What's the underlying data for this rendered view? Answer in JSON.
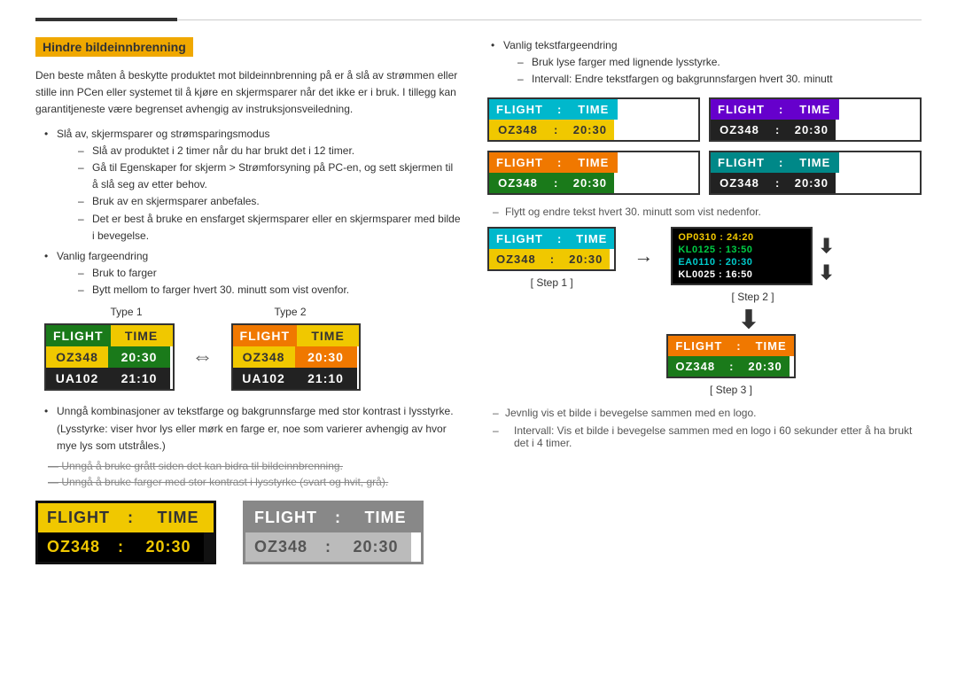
{
  "page": {
    "top_border_dark_width": 160
  },
  "section": {
    "title": "Hindre bildeinnbrenning",
    "intro": "Den beste måten å beskytte produktet mot bildeinnbrenning på er å slå av strømmen eller stille inn PCen eller systemet til å kjøre en skjermsparer når det ikke er i bruk. I tillegg kan garantitjeneste være begrenset avhengig av instruksjonsveiledning.",
    "bullets": [
      {
        "main": "Slå av, skjermsparer og strømsparingsmodus",
        "dashes": [
          "Slå av produktet i 2 timer når du har brukt det i 12 timer.",
          "Gå til Egenskaper for skjerm > Strømforsyning på PC-en, og sett skjermen til å slå seg av etter behov.",
          "Bruk av en skjermsparer anbefales.",
          "Det er best å bruke en ensfarget skjermsparer eller en skjermsparer med bilde i bevegelse."
        ]
      },
      {
        "main": "Vanlig fargeendring",
        "dashes": [
          "Bruk to farger",
          "Bytt mellom to farger hvert 30. minutt som vist ovenfor."
        ]
      }
    ],
    "type1_label": "Type 1",
    "type2_label": "Type 2",
    "board1": {
      "row1": [
        "FLIGHT",
        "TIME"
      ],
      "row2": [
        "OZ348",
        "20:30"
      ],
      "row3": [
        "UA102",
        "21:10"
      ]
    },
    "board2": {
      "row1": [
        "FLIGHT",
        "TIME"
      ],
      "row2": [
        "OZ348",
        "20:30"
      ],
      "row3": [
        "UA102",
        "21:10"
      ]
    },
    "avoid_bullet1": "Unngå kombinasjoner av tekstfarge og bakgrunnsfarge med stor kontrast i lysstyrke. (Lysstyrke: viser hvor lys eller mørk en farge er, noe som varierer avhengig av hvor mye lys som utstråles.)",
    "strikethrough1": "Unngå å bruke grått siden det kan bidra til bildeinnbrenning.",
    "strikethrough2": "Unngå å bruke farger med stor kontrast i lysstyrke (svart og hvit, grå).",
    "bottom_board_left": {
      "row1": [
        "FLIGHT",
        ":",
        "TIME"
      ],
      "row2": [
        "OZ348",
        ":",
        "20:30"
      ]
    },
    "bottom_board_right": {
      "row1": [
        "FLIGHT",
        ":",
        "TIME"
      ],
      "row2": [
        "OZ348",
        ":",
        "20:30"
      ]
    }
  },
  "right_section": {
    "bullet1_main": "Vanlig tekstfargeendring",
    "bullet1_dash1": "Bruk lyse farger med lignende lysstyrke.",
    "bullet1_dash2": "Intervall: Endre tekstfargen og bakgrunnsfargen hvert 30. minutt",
    "boards_grid": [
      {
        "id": "tl",
        "row1_cells": [
          "FLIGHT",
          ":",
          "TIME"
        ],
        "row2_cells": [
          "OZ348",
          ":",
          "20:30"
        ],
        "row1_colors": [
          "bg-cyan",
          "bg-cyan",
          "bg-cyan"
        ],
        "row2_colors": [
          "bg-yellow",
          "bg-yellow",
          "bg-yellow"
        ]
      },
      {
        "id": "tr",
        "row1_cells": [
          "FLIGHT",
          ":",
          "TIME"
        ],
        "row2_cells": [
          "OZ348",
          ":",
          "20:30"
        ],
        "row1_colors": [
          "bg-purple",
          "bg-purple",
          "bg-purple"
        ],
        "row2_colors": [
          "bg-dark",
          "bg-dark",
          "bg-dark"
        ]
      },
      {
        "id": "bl",
        "row1_cells": [
          "FLIGHT",
          ":",
          "TIME"
        ],
        "row2_cells": [
          "OZ348",
          ":",
          "20:30"
        ],
        "row1_colors": [
          "bg-orange",
          "bg-orange",
          "bg-orange"
        ],
        "row2_colors": [
          "bg-green",
          "bg-green",
          "bg-green"
        ]
      },
      {
        "id": "br",
        "row1_cells": [
          "FLIGHT",
          ":",
          "TIME"
        ],
        "row2_cells": [
          "OZ348",
          ":",
          "20:30"
        ],
        "row1_colors": [
          "bg-teal",
          "bg-teal",
          "bg-teal"
        ],
        "row2_colors": [
          "bg-dark",
          "bg-dark",
          "bg-dark"
        ]
      }
    ],
    "step_dash": "Flytt og endre tekst hvert 30. minutt som vist nedenfor.",
    "step1_label": "[ Step 1 ]",
    "step2_label": "[ Step 2 ]",
    "step3_label": "[ Step 3 ]",
    "step1_board": {
      "row1": [
        "FLIGHT",
        ":",
        "TIME"
      ],
      "row2": [
        "OZ348",
        ":",
        "20:30"
      ]
    },
    "step2_scroll": [
      {
        "text": "OP0310 : 24:20",
        "color": "sr-yellow"
      },
      {
        "text": "KL0125 : 13:50",
        "color": "sr-green"
      },
      {
        "text": "EA0110 : 20:30",
        "color": "sr-cyan"
      },
      {
        "text": "KL0025 : 16:50",
        "color": "sr-white"
      }
    ],
    "step3_board": {
      "row1": [
        "FLIGHT",
        ":",
        "TIME"
      ],
      "row2": [
        "OZ348",
        ":",
        "20:30"
      ]
    },
    "bottom_dash1": "Jevnlig vis et bilde i bevegelse sammen med en logo.",
    "bottom_dash2": "Intervall: Vis et bilde i bevegelse sammen med en logo i 60 sekunder etter å ha brukt det i 4 timer."
  }
}
